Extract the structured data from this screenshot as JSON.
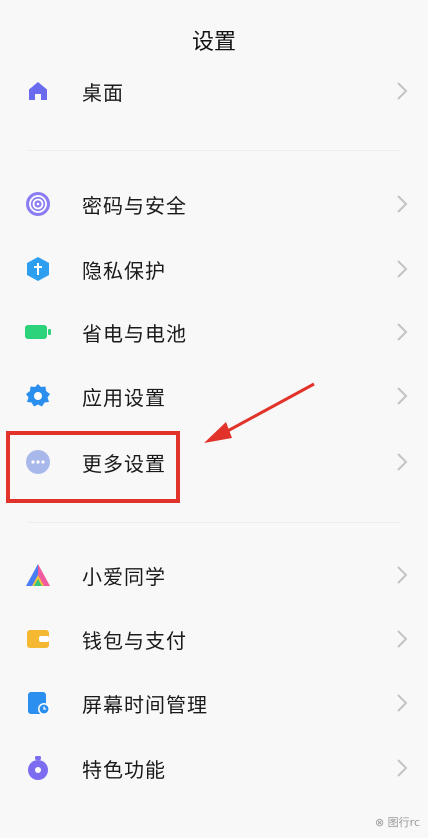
{
  "header": {
    "title": "设置"
  },
  "items": [
    {
      "label": "桌面",
      "icon": "home-icon"
    },
    {
      "label": "密码与安全",
      "icon": "fingerprint-icon"
    },
    {
      "label": "隐私保护",
      "icon": "privacy-shield-icon"
    },
    {
      "label": "省电与电池",
      "icon": "battery-icon"
    },
    {
      "label": "应用设置",
      "icon": "gear-icon"
    },
    {
      "label": "更多设置",
      "icon": "more-dots-icon"
    },
    {
      "label": "小爱同学",
      "icon": "xiaoai-icon"
    },
    {
      "label": "钱包与支付",
      "icon": "wallet-icon"
    },
    {
      "label": "屏幕时间管理",
      "icon": "screen-time-icon"
    },
    {
      "label": "特色功能",
      "icon": "features-icon"
    }
  ],
  "annotation": {
    "highlight_color": "#e2332a",
    "highlighted_item": "更多设置"
  },
  "watermark": "⊗ 图行rc"
}
